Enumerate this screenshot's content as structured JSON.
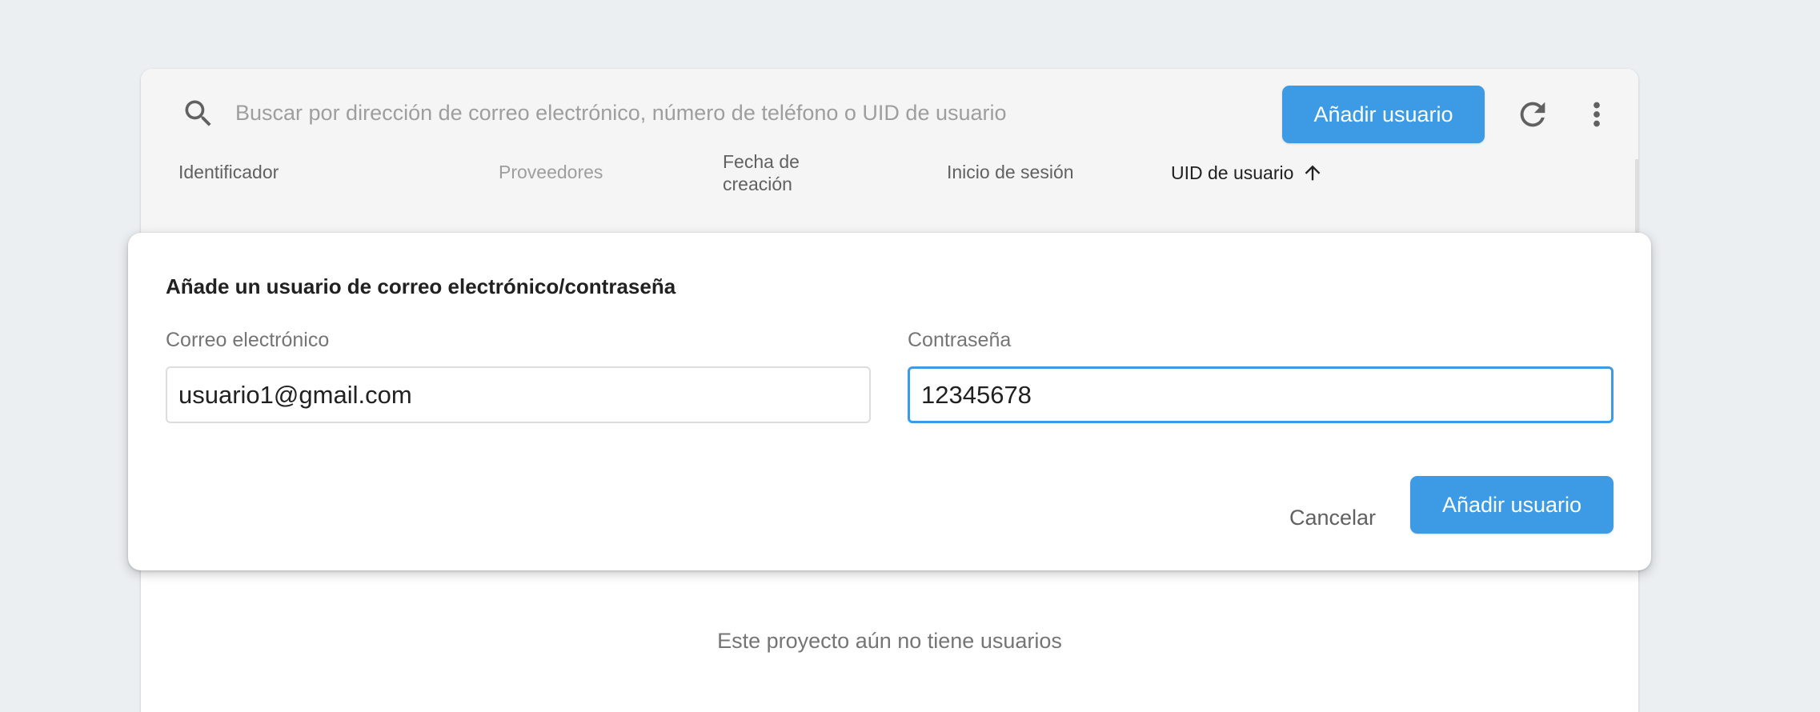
{
  "toolbar": {
    "search_placeholder": "Buscar por dirección de correo electrónico, número de teléfono o UID de usuario",
    "add_user_label": "Añadir usuario",
    "icons": [
      "search-icon",
      "refresh-icon",
      "more-vert-icon"
    ]
  },
  "table": {
    "columns": [
      {
        "label": "Identificador"
      },
      {
        "label": "Proveedores"
      },
      {
        "label": "Fecha de creación"
      },
      {
        "label": "Inicio de sesión"
      },
      {
        "label": "UID de usuario",
        "sort": "ascending",
        "sort_icon": "arrow-up-icon"
      }
    ],
    "empty_message": "Este proyecto aún no tiene usuarios"
  },
  "dialog": {
    "title": "Añade un usuario de correo electrónico/contraseña",
    "email": {
      "label": "Correo electrónico",
      "value": "usuario1@gmail.com"
    },
    "password": {
      "label": "Contraseña",
      "value": "12345678"
    },
    "cancel_label": "Cancelar",
    "submit_label": "Añadir usuario"
  },
  "colors": {
    "accent": "#3d9be5",
    "background": "#eceff1",
    "toolbar": "#f5f5f5"
  }
}
